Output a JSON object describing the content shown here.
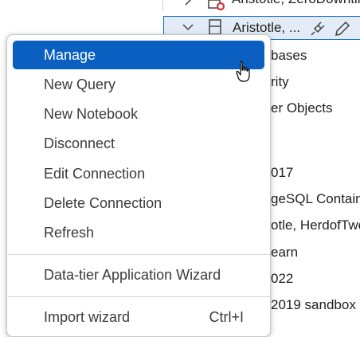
{
  "tree": {
    "rows": [
      {
        "label": "Aristotle, ZeroDowntime"
      },
      {
        "label": "Aristotle, ..."
      }
    ],
    "partial_items": [
      "bases",
      "rity",
      "er Objects",
      "017",
      "geSQL Contain",
      "otle, HerdofTwo",
      "earn",
      "022",
      "2019 sandbox"
    ],
    "icons": {
      "expand": "chevron-right-icon",
      "collapse": "chevron-down-icon",
      "server": "server-icon",
      "status": "disconnected-status-icon",
      "connect": "plug-icon",
      "edit": "pencil-icon"
    }
  },
  "menu": {
    "items": [
      {
        "label": "Manage"
      },
      {
        "label": "New Query"
      },
      {
        "label": "New Notebook"
      },
      {
        "label": "Disconnect"
      },
      {
        "label": "Edit Connection"
      },
      {
        "label": "Delete Connection"
      },
      {
        "label": "Refresh"
      },
      {
        "label": "Data-tier Application Wizard"
      },
      {
        "label": "Import wizard",
        "shortcut": "Ctrl+I"
      }
    ],
    "active_index": 0
  },
  "colors": {
    "active_bg": "#0a5fc1",
    "active_fg": "#ffffff",
    "text": "#3b3b3b",
    "selection_border": "#0b6bcb",
    "status_red": "#d13438"
  }
}
